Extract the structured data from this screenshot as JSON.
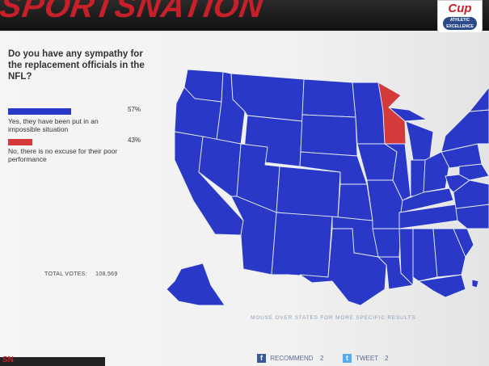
{
  "header": {
    "title": "SPORTSNATION",
    "logo_word": "Cup",
    "logo_badge": "ATHLETIC EXCELLENCE"
  },
  "poll": {
    "question": "Do you have any sympathy for the replacement officials in the NFL?",
    "answers": [
      {
        "text": "Yes, they have been put in an impossible situation",
        "percent": "57%",
        "share": 57,
        "color": "#2a38c8"
      },
      {
        "text": "No, there is no excuse for their poor performance",
        "percent": "43%",
        "share": 43,
        "color": "#d43a3a"
      }
    ],
    "total_label": "TOTAL VOTES:",
    "total_votes": "108,569"
  },
  "map": {
    "hint": "MOUSE OVER STATES FOR MORE SPECIFIC RESULTS",
    "majority_color": "#2a38c8",
    "minority_state": "Wisconsin",
    "minority_color": "#d43a3a"
  },
  "social": {
    "recommend_label": "RECOMMEND",
    "recommend_count": "2",
    "tweet_label": "TWEET",
    "tweet_count": "2"
  },
  "footer": {
    "brand": "SN"
  }
}
